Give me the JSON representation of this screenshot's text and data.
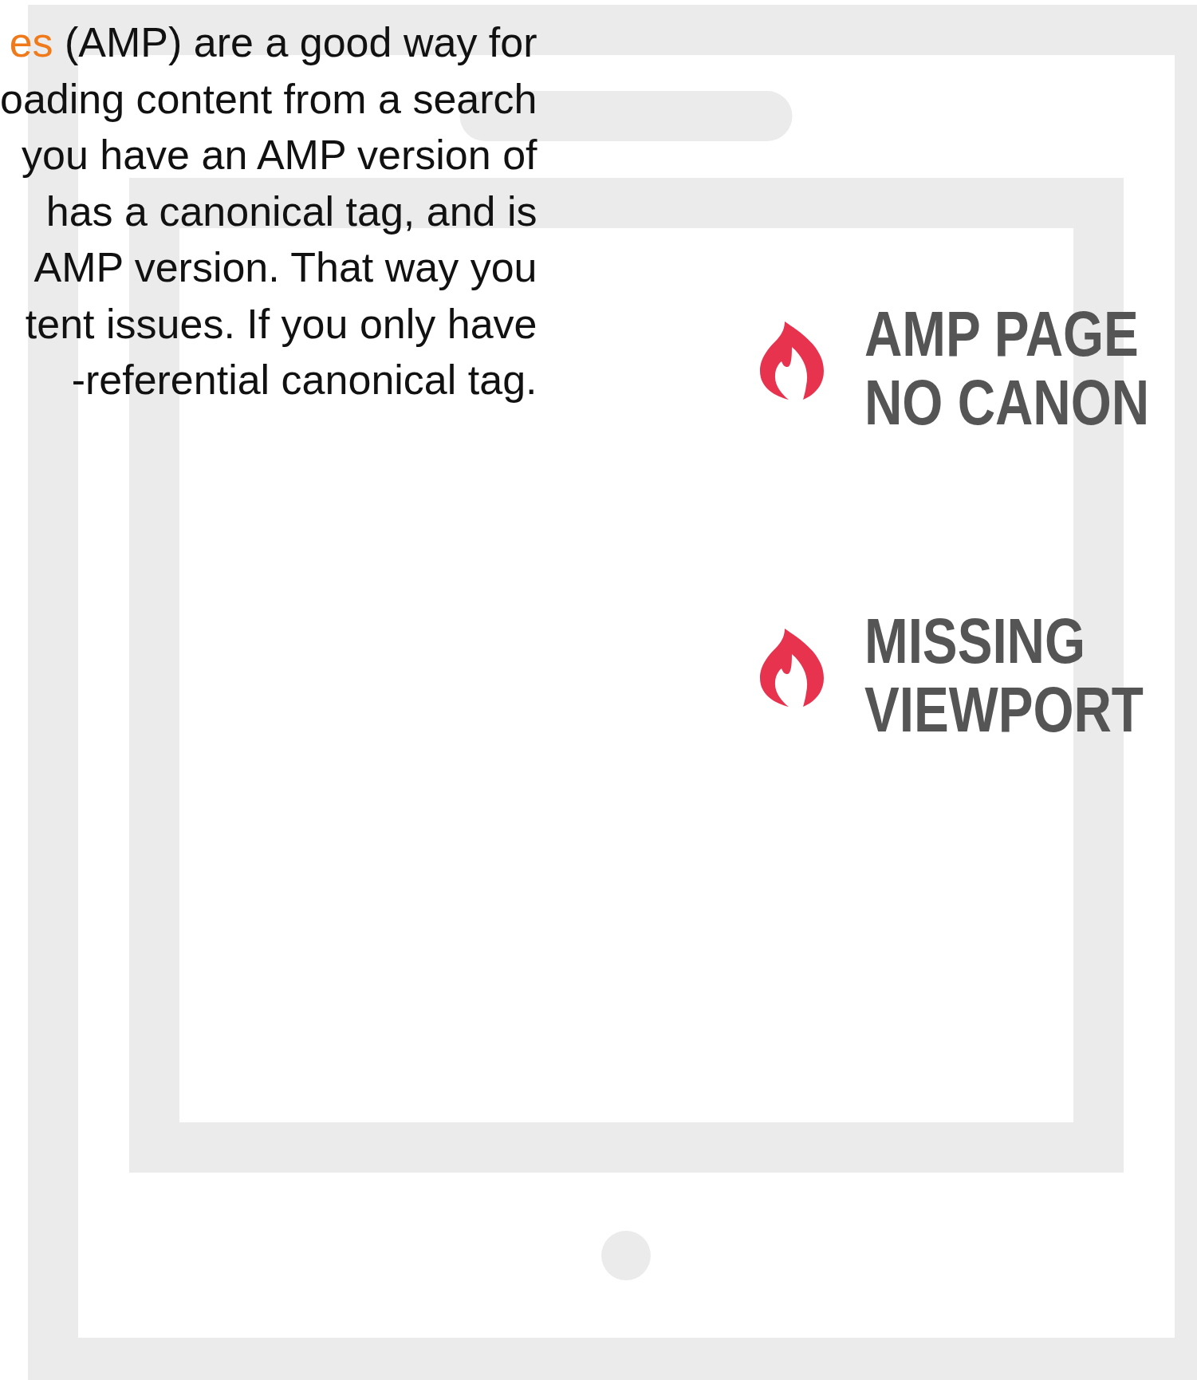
{
  "article": {
    "link": "es",
    "lines": [
      "(AMP) are a good way for",
      "oading content from a search",
      "you have an AMP version of",
      "has a canonical tag, and is",
      "AMP version. That way you",
      "tent issues. If you only have",
      "-referential canonical tag."
    ]
  },
  "issues": [
    {
      "lines": [
        "AMP PAGE",
        "NO CANON"
      ]
    },
    {
      "lines": [
        "MISSING",
        "VIEWPORT"
      ]
    }
  ]
}
